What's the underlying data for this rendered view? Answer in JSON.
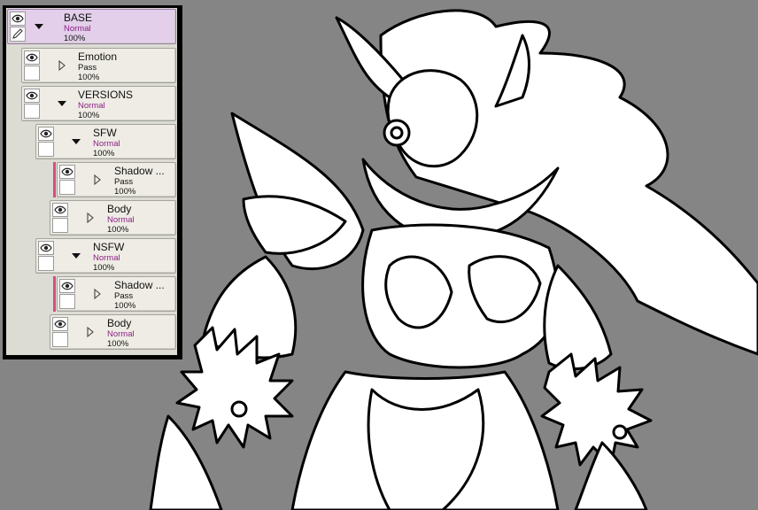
{
  "layers": [
    {
      "name": "BASE",
      "blend": "Normal",
      "opacity": "100%",
      "expanded": true,
      "selected": true
    },
    {
      "name": "Emotion",
      "blend": "Pass",
      "opacity": "100%",
      "expanded": false
    },
    {
      "name": "VERSIONS",
      "blend": "Normal",
      "opacity": "100%",
      "expanded": true
    },
    {
      "name": "SFW",
      "blend": "Normal",
      "opacity": "100%",
      "expanded": true
    },
    {
      "name": "Shadow ...",
      "blend": "Pass",
      "opacity": "100%",
      "expanded": false,
      "clipped": true
    },
    {
      "name": "Body",
      "blend": "Normal",
      "opacity": "100%",
      "expanded": false
    },
    {
      "name": "NSFW",
      "blend": "Normal",
      "opacity": "100%",
      "expanded": true
    },
    {
      "name": "Shadow ...",
      "blend": "Pass",
      "opacity": "100%",
      "expanded": false,
      "clipped": true
    },
    {
      "name": "Body",
      "blend": "Normal",
      "opacity": "100%",
      "expanded": false
    }
  ],
  "colors": {
    "canvas_background": "#858585",
    "selected_layer": "#e3cfea",
    "blend_normal_text": "#8c1f86",
    "clip_accent": "#d84d83"
  },
  "icons": {
    "visibility": "eye-icon",
    "edit": "pencil-icon",
    "expanded": "triangle-down-icon",
    "collapsed": "triangle-right-icon"
  }
}
